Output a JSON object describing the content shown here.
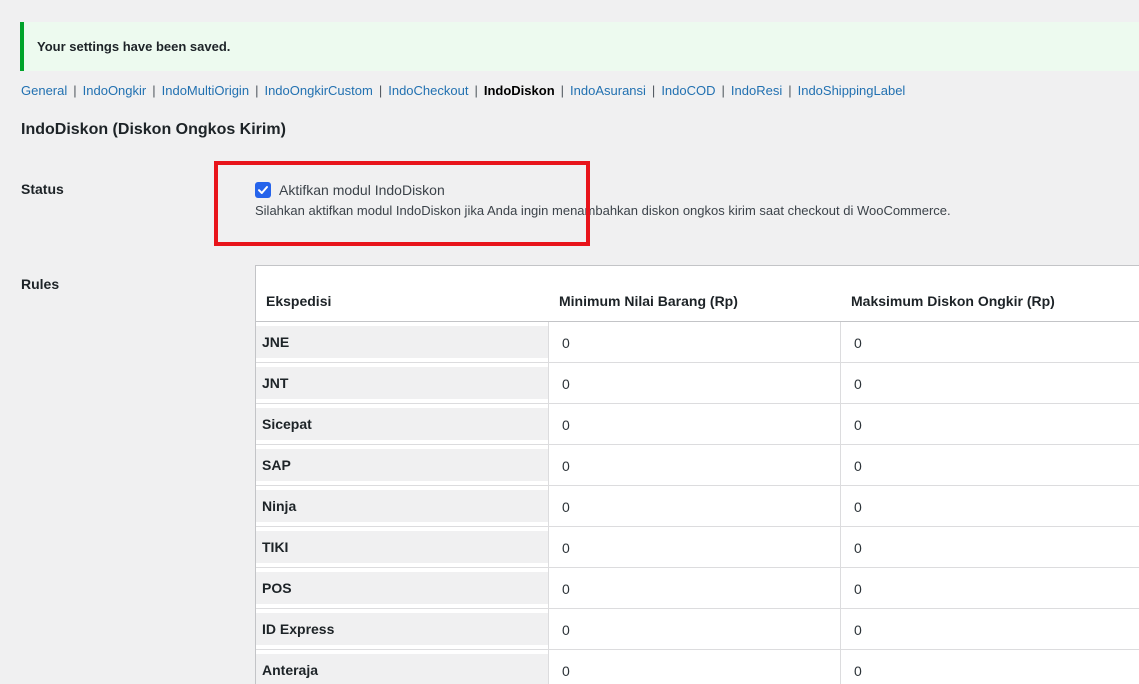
{
  "notice": {
    "message": "Your settings have been saved."
  },
  "subnav": {
    "separator": "|",
    "items": [
      {
        "label": "General",
        "current": false
      },
      {
        "label": "IndoOngkir",
        "current": false
      },
      {
        "label": "IndoMultiOrigin",
        "current": false
      },
      {
        "label": "IndoOngkirCustom",
        "current": false
      },
      {
        "label": "IndoCheckout",
        "current": false
      },
      {
        "label": "IndoDiskon",
        "current": true
      },
      {
        "label": "IndoAsuransi",
        "current": false
      },
      {
        "label": "IndoCOD",
        "current": false
      },
      {
        "label": "IndoResi",
        "current": false
      },
      {
        "label": "IndoShippingLabel",
        "current": false
      }
    ]
  },
  "page": {
    "title": "IndoDiskon (Diskon Ongkos Kirim)"
  },
  "status": {
    "label": "Status",
    "checkbox_label": "Aktifkan modul IndoDiskon",
    "checked": true,
    "description": "Silahkan aktifkan modul IndoDiskon jika Anda ingin menambahkan diskon ongkos kirim saat checkout di WooCommerce."
  },
  "rules": {
    "label": "Rules",
    "columns": [
      "Ekspedisi",
      "Minimum Nilai Barang (Rp)",
      "Maksimum Diskon Ongkir (Rp)"
    ],
    "rows": [
      {
        "name": "JNE",
        "min": "0",
        "max": "0"
      },
      {
        "name": "JNT",
        "min": "0",
        "max": "0"
      },
      {
        "name": "Sicepat",
        "min": "0",
        "max": "0"
      },
      {
        "name": "SAP",
        "min": "0",
        "max": "0"
      },
      {
        "name": "Ninja",
        "min": "0",
        "max": "0"
      },
      {
        "name": "TIKI",
        "min": "0",
        "max": "0"
      },
      {
        "name": "POS",
        "min": "0",
        "max": "0"
      },
      {
        "name": "ID Express",
        "min": "0",
        "max": "0"
      },
      {
        "name": "Anteraja",
        "min": "0",
        "max": "0"
      }
    ]
  },
  "colors": {
    "accent": "#2271b1",
    "checkbox": "#2563eb",
    "highlight": "#e8141b",
    "success": "#00a32a"
  }
}
